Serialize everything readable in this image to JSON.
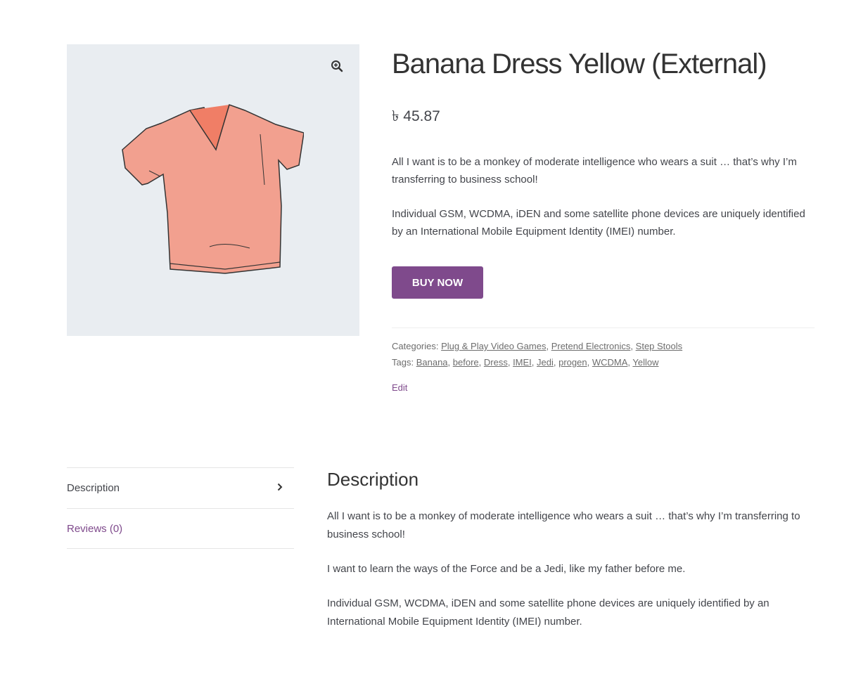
{
  "product": {
    "title": "Banana Dress Yellow (External)",
    "price": "৳ 45.87",
    "short_description": [
      "All I want is to be a monkey of moderate intelligence who wears a suit … that’s why I’m transferring to business school!",
      "Individual GSM, WCDMA, iDEN and some satellite phone devices are uniquely identified by an International Mobile Equipment Identity (IMEI) number."
    ],
    "buy_label": "BUY NOW",
    "categories_label": "Categories:",
    "categories": [
      "Plug & Play Video Games",
      "Pretend Electronics",
      "Step Stools"
    ],
    "tags_label": "Tags:",
    "tags": [
      "Banana",
      "before",
      "Dress",
      "IMEI",
      "Jedi",
      "progen",
      "WCDMA",
      "Yellow"
    ],
    "edit_label": "Edit"
  },
  "tabs": [
    {
      "label": "Description",
      "active": true
    },
    {
      "label": "Reviews (0)",
      "active": false
    }
  ],
  "description": {
    "heading": "Description",
    "paragraphs": [
      "All I want is to be a monkey of moderate intelligence who wears a suit … that’s why I’m transferring to business school!",
      "I want to learn the ways of the Force and be a Jedi, like my father before me.",
      "Individual GSM, WCDMA, iDEN and some satellite phone devices are uniquely identified by an International Mobile Equipment Identity (IMEI) number."
    ]
  },
  "icons": {
    "zoom": "zoom-in-icon",
    "chevron": "chevron-right-icon"
  },
  "colors": {
    "accent": "#7f4a8c",
    "gallery_bg": "#e9edf1",
    "shirt": "#f2a08f"
  }
}
